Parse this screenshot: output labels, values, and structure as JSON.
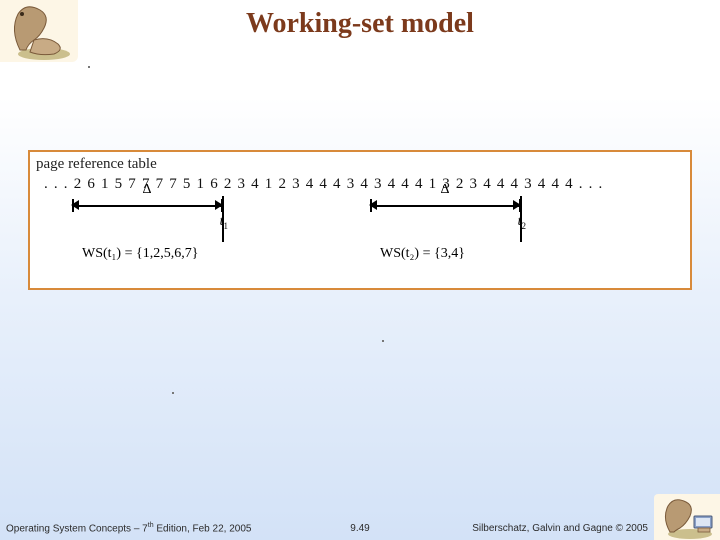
{
  "title": "Working-set model",
  "diagram": {
    "label": "page reference table",
    "reference_string": ". . . 2 6 1 5 7 7 7 7 5 1 6 2 3 4 1 2 3 4 4 4 3 4 3 4 4 4 1 3 2 3 4 4 4 3 4 4 4 . . .",
    "window1": {
      "delta": "Δ",
      "t_label": "t",
      "t_sub": "1",
      "ws": "WS(t₁) = {1,2,5,6,7}"
    },
    "window2": {
      "delta": "Δ",
      "t_label": "t",
      "t_sub": "2",
      "ws": "WS(t₂) = {3,4}"
    }
  },
  "footer": {
    "left_a": "Operating System Concepts – 7",
    "left_sup": "th",
    "left_b": " Edition, Feb 22, 2005",
    "center": "9.49",
    "right": "Silberschatz, Galvin and Gagne © 2005"
  }
}
